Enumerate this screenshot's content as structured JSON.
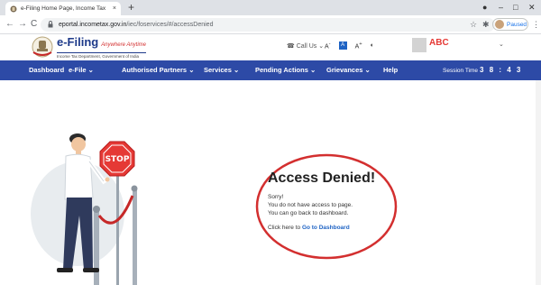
{
  "browser": {
    "tab_title": "e-Filing Home Page, Income Tax",
    "tab_close": "×",
    "new_tab": "+",
    "url_host": "eportal.incometax.gov.in",
    "url_path": "/iec/foservices/#/accessDenied",
    "profile_status": "Paused",
    "icons": {
      "back": "back-arrow-icon",
      "forward": "forward-arrow-icon",
      "reload": "reload-icon",
      "star": "star-icon",
      "extensions": "puzzle-icon",
      "menu": "kebab-menu-icon"
    }
  },
  "header": {
    "brand_name": "e-Filing",
    "brand_tagline": "Anywhere Anytime",
    "brand_department": "Income Tax Department, Government of India",
    "call_us": "Call Us",
    "font_small": "A",
    "font_default": "A",
    "font_large": "A",
    "user_name": "ABC"
  },
  "nav": {
    "items": [
      {
        "label": "Dashboard"
      },
      {
        "label": "e-File"
      },
      {
        "label": "Authorised Partners"
      },
      {
        "label": "Services"
      },
      {
        "label": "Pending Actions"
      },
      {
        "label": "Grievances"
      },
      {
        "label": "Help"
      }
    ],
    "session_label": "Session Time",
    "session_time": "3 8 : 4 3"
  },
  "message": {
    "title": "Access Denied!",
    "line1": "Sorry!",
    "line2": "You do not have access to page.",
    "line3": "You can go back to dashboard.",
    "link_prefix": "Click here to",
    "link_text": "Go to Dashboard"
  },
  "illustration": {
    "sign_text": "STOP"
  },
  "colors": {
    "nav_bg": "#2d4aa6",
    "brand_blue": "#1e3a8a",
    "annotation_red": "#d32f2f",
    "link_blue": "#1e63c4",
    "user_name_red": "#e53935"
  }
}
